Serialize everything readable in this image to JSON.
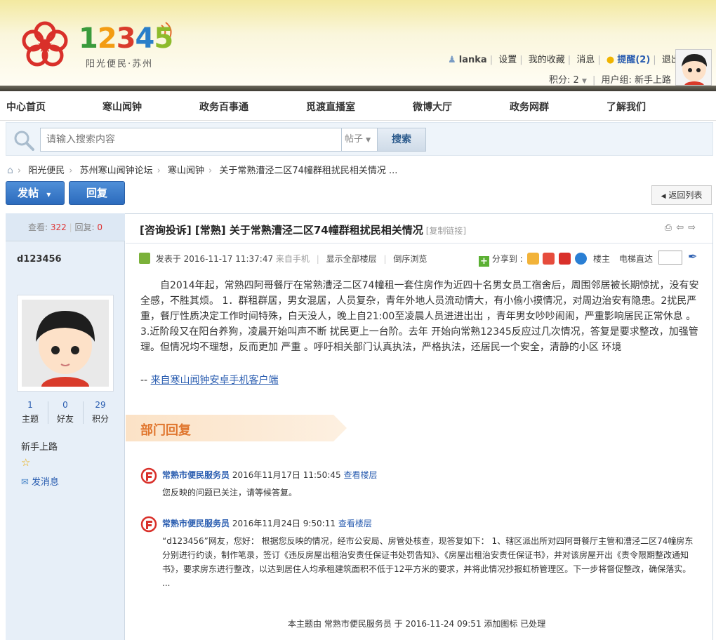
{
  "header": {
    "logo_number": "12345",
    "logo_subtitle": "阳光便民·苏州",
    "user_name": "lanka",
    "settings": "设置",
    "favorites": "我的收藏",
    "messages": "消息",
    "reminder": "提醒(2)",
    "logout": "退出",
    "points": "积分: 2",
    "user_group": "用户组: 新手上路"
  },
  "nav": {
    "items": [
      "中心首页",
      "寒山闻钟",
      "政务百事通",
      "觅渡直播室",
      "微博大厅",
      "政务网群",
      "了解我们"
    ]
  },
  "search": {
    "placeholder": "请输入搜索内容",
    "type": "帖子",
    "button": "搜索"
  },
  "breadcrumb": [
    "阳光便民",
    "苏州寒山闻钟论坛",
    "寒山闻钟",
    "关于常熟漕泾二区74幢群租扰民相关情况 ..."
  ],
  "actions": {
    "post": "发帖",
    "reply": "回复",
    "back": "返回列表"
  },
  "sidebar": {
    "views_label": "查看:",
    "views": "322",
    "replies_label": "回复:",
    "replies": "0",
    "author": "d123456",
    "stats": [
      {
        "value": "1",
        "label": "主题"
      },
      {
        "value": "0",
        "label": "好友"
      },
      {
        "value": "29",
        "label": "积分"
      }
    ],
    "group": "新手上路",
    "send_message": "发消息"
  },
  "post": {
    "title": "[咨询投诉] [常熟] 关于常熟漕泾二区74幢群租扰民相关情况",
    "copy_link": "[复制链接]",
    "posted_at": "发表于 2016-11-17 11:37:47",
    "from_mobile": "来自手机",
    "show_all": "显示全部楼层",
    "reverse": "倒序浏览",
    "share_label": "分享到 :",
    "floor": "楼主",
    "elevator": "电梯直达",
    "content": "自2014年起，常熟四阿哥餐厅在常熟漕泾二区74幢租一套住房作为近四十名男女员工宿舍后，周围邻居被长期惊扰，没有安全感，不胜其烦。  1．群租群居，男女混居，人员复杂，青年外地人员流动情大，有小偷小摸情况，对周边治安有隐患。2扰民严重，餐厅性质决定工作时间特殊，白天没人，晚上自21:00至凌晨人员进进出出   ，青年男女吵吵闹闹，严重影响居民正常休息   。3.近阶段又在阳台养狗，凌晨开始叫声不断 扰民更上一台阶。去年 开始向常熟12345反应过几次情况，答复是要求整改，加强管理。但情况均不理想，反而更加 严重 。呼吁相关部门认真执法，严格执法，还居民一个安全，清静的小区 环境",
    "source_prefix": "-- ",
    "source_link": "来自寒山闻钟安卓手机客户端"
  },
  "dept_reply": {
    "title": "部门回复",
    "replies": [
      {
        "org": "常熟市便民服务员",
        "time": "2016年11月17日 11:50:45",
        "link": "查看楼层",
        "body": "您反映的问题已关注，请等候答复。"
      },
      {
        "org": "常熟市便民服务员",
        "time": "2016年11月24日 9:50:11",
        "link": "查看楼层",
        "body": "“d123456”网友，您好： 根据您反映的情况，经市公安局、房管处核查，现答复如下： 1、辖区派出所对四阿哥餐厅主管和漕泾二区74幢房东分别进行约谈，制作笔录，签订《违反房屋出租治安责任保证书处罚告知》、《房屋出租治安责任保证书》，并对该房屋开出《责令限期整改通知书》，要求房东进行整改，以达到居住人均承租建筑面积不低于12平方米的要求，并将此情况抄报虹桥管理区。下一步将督促整改，确保落实。 ..."
      }
    ]
  },
  "footer_note": "本主题由 常熟市便民服务员 于 2016-11-24 09:51 添加图标 已处理",
  "colors": {
    "accent_blue": "#2a5db0",
    "dept_orange": "#e0762e",
    "sidebar_bg": "#e7eff8"
  }
}
